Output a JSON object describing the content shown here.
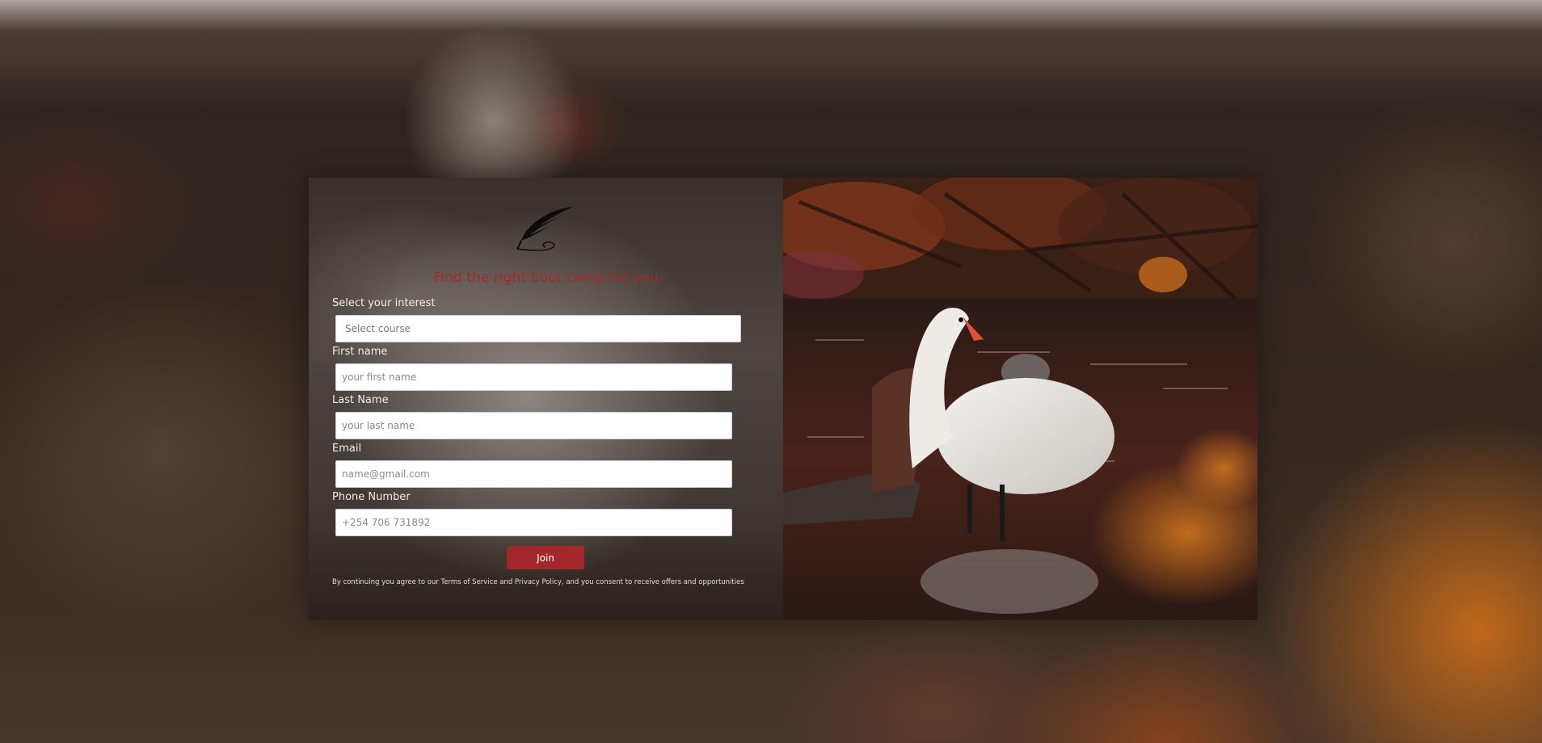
{
  "form": {
    "title": "Find the right boot camp for you",
    "logo_icon": "quill-feather-icon",
    "interest": {
      "label": "Select your interest",
      "selected_value": "Select course"
    },
    "first_name": {
      "label": "First name",
      "placeholder": "your first name",
      "value": ""
    },
    "last_name": {
      "label": "Last Name",
      "placeholder": "your last name",
      "value": ""
    },
    "email": {
      "label": "Email",
      "placeholder": "name@gmail.com",
      "value": ""
    },
    "phone": {
      "label": "Phone Number",
      "placeholder": "+254 706 731892",
      "value": ""
    },
    "join_label": "Join",
    "disclaimer": "By continuing you agree to our Terms of Service and Privacy Policy, and you consent to receive offers and opportunities"
  },
  "image": {
    "subject": "white swan standing in dark water with autumn foliage"
  },
  "colors": {
    "accent": "#a3272a",
    "title": "#a8282b"
  }
}
